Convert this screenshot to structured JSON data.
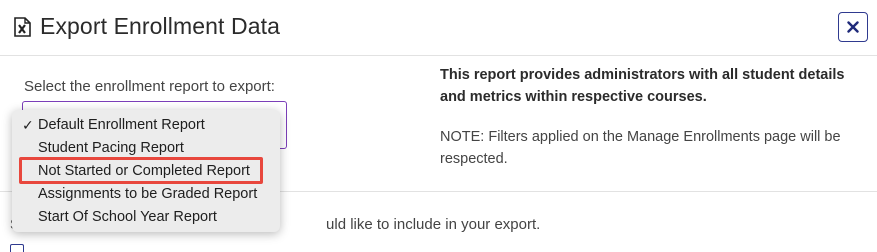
{
  "dialog": {
    "title": "Export Enrollment Data",
    "icon": "excel-export-icon",
    "close_icon": "close-icon"
  },
  "report_select": {
    "prompt": "Select the enrollment report to export:",
    "selected": "Default Enrollment Report",
    "options": [
      "Default Enrollment Report",
      "Student Pacing Report",
      "Not Started or Completed Report",
      "Assignments to be Graded Report",
      "Start Of School Year Report"
    ],
    "highlighted_option": "Not Started or Completed Report"
  },
  "report_info": {
    "description": "This report provides administrators with all student details and metrics within respective courses.",
    "note": "NOTE: Filters applied on the Manage Enrollments page will be respected."
  },
  "include_section": {
    "prompt_visible_start": "S",
    "prompt_visible_end": "uld like to include in your export."
  },
  "colors": {
    "accent_purple": "#7b3fb8",
    "navy": "#2f3a8f",
    "highlight_red": "#e8473d"
  }
}
